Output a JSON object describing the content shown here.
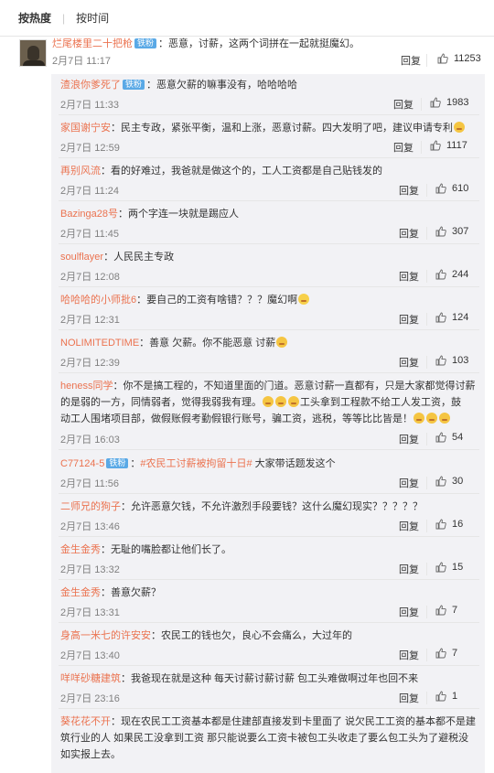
{
  "sort": {
    "hot": "按热度",
    "time": "按时间"
  },
  "top_comment": {
    "user": "烂尾楼里二十把枪",
    "badge": "铁粉",
    "text": "：恶意，讨薪，这两个词拼在一起就挺魔幻。",
    "time": "2月7日 11:17",
    "reply_label": "回复",
    "likes": "11253"
  },
  "replies": [
    {
      "user": "渣浪你爹死了",
      "badge": "铁粉",
      "text": "：恶意欠薪的嘛事没有，哈哈哈哈",
      "time": "2月7日 11:33",
      "reply_label": "回复",
      "likes": "1983"
    },
    {
      "user": "家国谢宁安",
      "text": "：民主专政，紧张平衡，温和上涨，恶意讨薪。四大发明了吧，建议申请专利",
      "time": "2月7日 12:59",
      "reply_label": "回复",
      "likes": "1117"
    },
    {
      "user": "再别风流",
      "text": "：看的好难过，我爸就是做这个的，工人工资都是自己贴钱发的",
      "time": "2月7日 11:24",
      "reply_label": "回复",
      "likes": "610"
    },
    {
      "user": "Bazinga28号",
      "text": "：两个字连一块就是踢应人",
      "time": "2月7日 11:45",
      "reply_label": "回复",
      "likes": "307"
    },
    {
      "user": "soulflayer",
      "text": "：人民民主专政",
      "time": "2月7日 12:08",
      "reply_label": "回复",
      "likes": "244"
    },
    {
      "user": "哈哈哈的小师批6",
      "text": "：要自己的工资有啥错？？？魔幻啊",
      "time": "2月7日 12:31",
      "reply_label": "回复",
      "likes": "124"
    },
    {
      "user": "NOLIMITEDTIME",
      "text": "：善意 欠薪。你不能恶意 讨薪",
      "time": "2月7日 12:39",
      "reply_label": "回复",
      "likes": "103"
    },
    {
      "user": "heness同学",
      "text_l1": "：你不是搞工程的，不知道里面的门道。恶意讨薪一直都有，只是大家都觉得讨薪",
      "text_l2a": "的是弱的一方，同情弱者，觉得我弱我有理。",
      "text_l2b": "工头拿到工程款不给工人发工资，鼓",
      "text_l3": "动工人围堵项目部，做假账假考勤假银行账号，骗工资，逃税，等等比比皆是！",
      "time": "2月7日 16:03",
      "reply_label": "回复",
      "likes": "54"
    },
    {
      "user": "C77124-5",
      "badge": "铁粉",
      "text_pre": "：",
      "topic": "#农民工讨薪被拘留十日#",
      "text_post": " 大家带话题发这个",
      "time": "2月7日 11:56",
      "reply_label": "回复",
      "likes": "30"
    },
    {
      "user": "二师兄的狗子",
      "text": "：允许恶意欠钱，不允许激烈手段要钱？这什么魔幻现实？？？？？",
      "time": "2月7日 13:46",
      "reply_label": "回复",
      "likes": "16"
    },
    {
      "user": "金生金秀",
      "text": "：无耻的嘴脸都让他们长了。",
      "time": "2月7日 13:32",
      "reply_label": "回复",
      "likes": "15"
    },
    {
      "user": "金生金秀",
      "text": "：善意欠薪？",
      "time": "2月7日 13:31",
      "reply_label": "回复",
      "likes": "7"
    },
    {
      "user": "身高一米七的许安安",
      "text": "：农民工的钱也欠，良心不会痛么，大过年的",
      "time": "2月7日 13:40",
      "reply_label": "回复",
      "likes": "7"
    },
    {
      "user": "咩咩砂糖建筑",
      "text": "：我爸现在就是这种 每天讨薪讨薪讨薪 包工头难做啊过年也回不来",
      "time": "2月7日 23:16",
      "reply_label": "回复",
      "likes": "1"
    },
    {
      "user": "葵花花不开",
      "text_l1": "：现在农民工工资基本都是住建部直接发到卡里面了 说欠民工工资的基本都不是建",
      "text_l2": "筑行业的人 如果民工没拿到工资 那只能说要么工资卡被包工头收走了要么包工头为了避税没",
      "text_l3": "如实报上去。"
    }
  ]
}
